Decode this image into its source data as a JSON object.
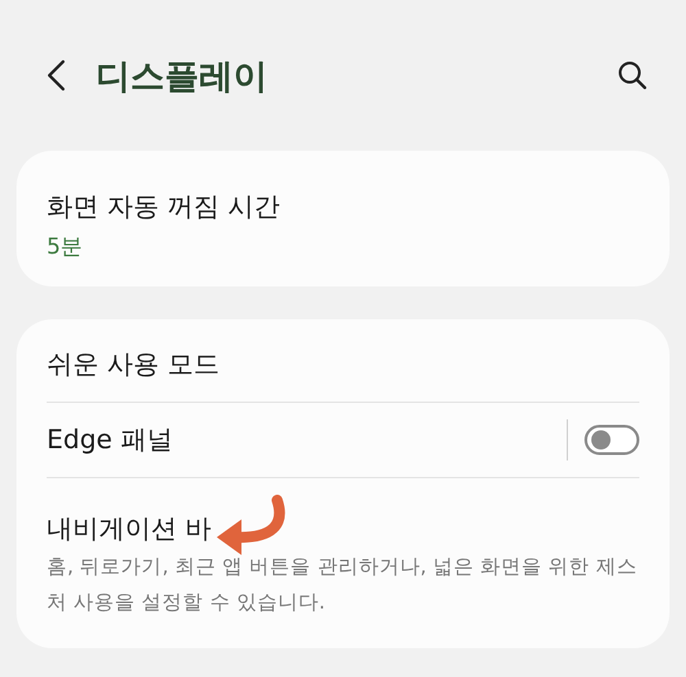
{
  "header": {
    "title": "디스플레이"
  },
  "cards": [
    {
      "rows": [
        {
          "kind": "value",
          "label": "화면 자동 꺼짐 시간",
          "value": "5분"
        }
      ]
    },
    {
      "rows": [
        {
          "kind": "plain",
          "label": "쉬운 사용 모드"
        },
        {
          "kind": "switch",
          "label": "Edge 패널",
          "on": false
        },
        {
          "kind": "description",
          "label": "내비게이션 바",
          "description": "홈, 뒤로가기, 최근 앱 버튼을 관리하거나, 넓은 화면을 위한 제스처 사용을 설정할 수 있습니다.",
          "pointer": true
        }
      ]
    }
  ]
}
